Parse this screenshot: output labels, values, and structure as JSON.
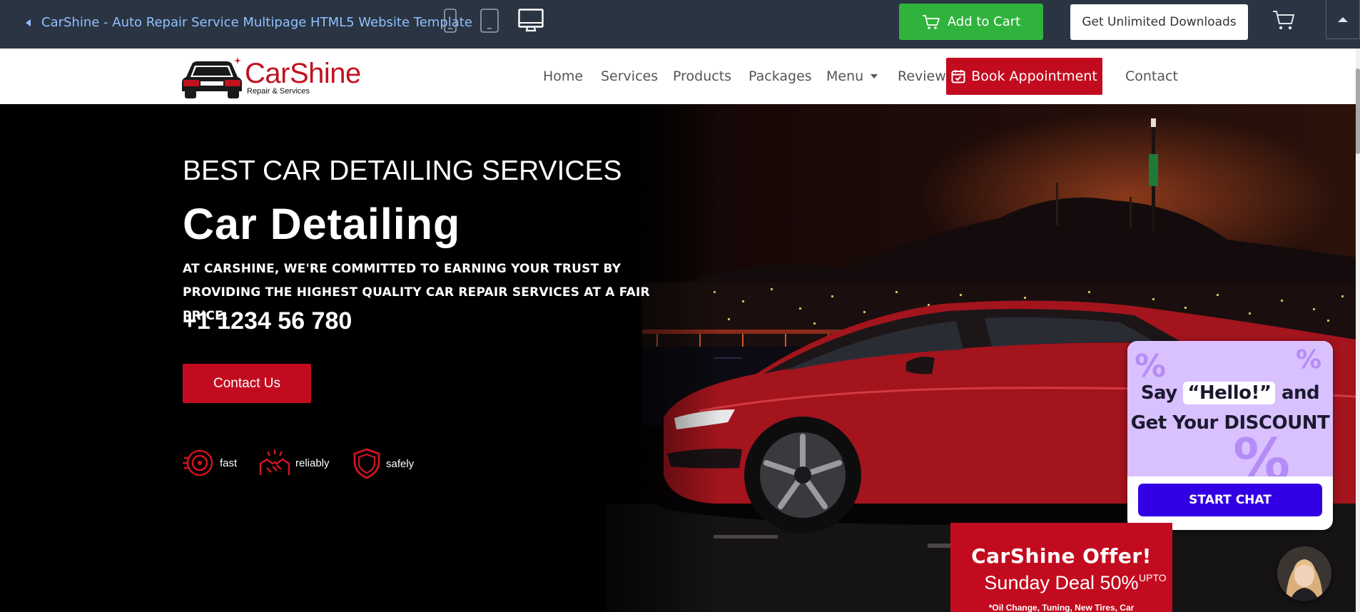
{
  "preview_bar": {
    "template_title": "CarShine - Auto Repair Service Multipage HTML5 Website Template",
    "devices": [
      "mobile-icon",
      "tablet-icon",
      "desktop-icon"
    ],
    "add_to_cart": "Add to Cart",
    "unlimited_downloads": "Get Unlimited Downloads"
  },
  "site": {
    "logo_title": "CarShine",
    "logo_sub": "Repair & Services",
    "nav": {
      "home": "Home",
      "services": "Services",
      "products": "Products",
      "packages": "Packages",
      "menu": "Menu",
      "review": "Review",
      "book": "Book Appointment",
      "contact": "Contact"
    }
  },
  "hero": {
    "subtitle": "BEST CAR DETAILING SERVICES",
    "title": "Car Detailing",
    "description": "AT CARSHINE, WE'RE COMMITTED TO EARNING YOUR TRUST BY PROVIDING THE HIGHEST QUALITY CAR REPAIR SERVICES AT A FAIR PRICE.",
    "phone": "+1 1234 56 780",
    "cta": "Contact Us",
    "features": [
      "fast",
      "reliably",
      "safely"
    ]
  },
  "promo": {
    "say": "Say",
    "hello": "“Hello!”",
    "and": "and",
    "line2": "Get Your DISCOUNT",
    "chat_button": "START CHAT"
  },
  "offer": {
    "title": "CarShine Offer!",
    "deal": "Sunday Deal 50%",
    "upto": "UPTO",
    "text": "*Oil Change, Tuning, New Tires, Car"
  },
  "colors": {
    "brand_red": "#c30b1f",
    "cart_green": "#30b33d",
    "topbar": "#2b3443",
    "chat_purple": "#3300e6",
    "promo_lavender": "#d9c0ff"
  }
}
